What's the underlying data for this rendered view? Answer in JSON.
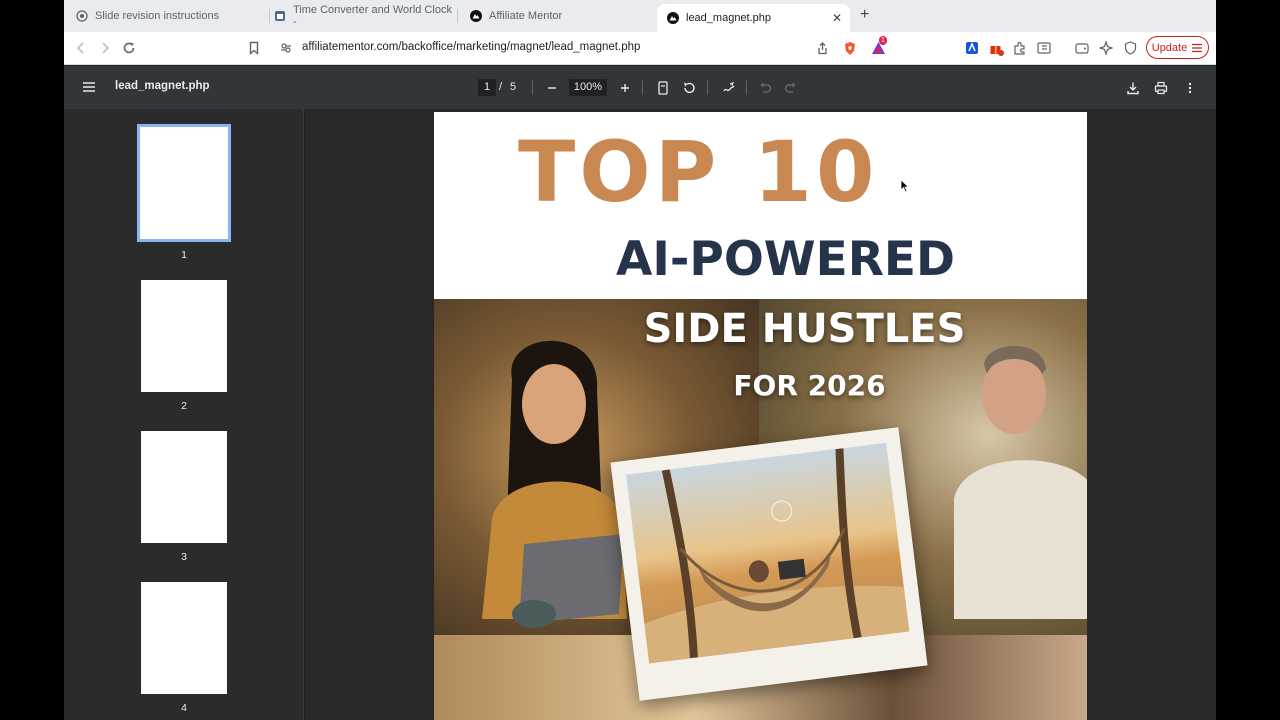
{
  "tabs": [
    {
      "title": "Slide revision instructions"
    },
    {
      "title": "Time Converter and World Clock -"
    },
    {
      "title": "Affiliate Mentor"
    },
    {
      "title": "lead_magnet.php"
    }
  ],
  "address_bar": {
    "url": "affiliatementor.com/backoffice/marketing/magnet/lead_magnet.php"
  },
  "toolbar": {
    "update_label": "Update",
    "extension_badge": "1"
  },
  "pdf": {
    "file_name": "lead_magnet.php",
    "current_page": "1",
    "page_separator": "/",
    "total_pages": "5",
    "zoom": "100%"
  },
  "thumbnails": [
    {
      "number": "1",
      "selected": true
    },
    {
      "number": "2",
      "selected": false
    },
    {
      "number": "3",
      "selected": false
    },
    {
      "number": "4",
      "selected": false
    }
  ],
  "document": {
    "headline_1": "TOP 10",
    "headline_2": "AI-POWERED",
    "headline_3": "SIDE HUSTLES",
    "headline_4": "FOR 2026"
  },
  "colors": {
    "accent_orange": "#c98852",
    "navy": "#26344b",
    "pdf_toolbar": "#323639",
    "selection": "#8ab4f8"
  }
}
